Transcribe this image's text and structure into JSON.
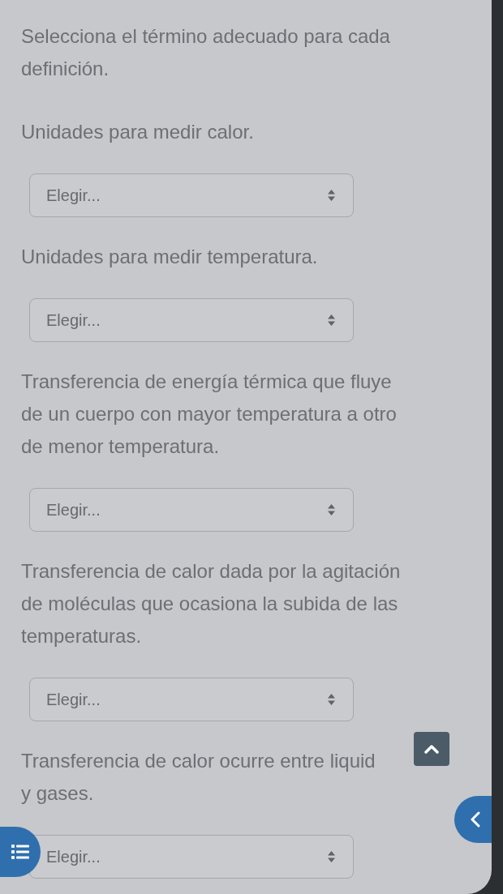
{
  "instructions": "Selecciona el término adecuado para cada definición.",
  "questions": [
    {
      "text": "Unidades para medir calor.",
      "answer": {
        "value": "Elegir..."
      }
    },
    {
      "text": "Unidades para medir temperatura.",
      "answer": {
        "value": "Elegir..."
      }
    },
    {
      "text": "Transferencia de energía térmica que fluye de un cuerpo con mayor temperatura a otro de menor temperatura.",
      "answer": {
        "value": "Elegir..."
      }
    },
    {
      "text": "Transferencia de calor dada por la agitación de moléculas que ocasiona la subida de las temperaturas.",
      "answer": {
        "value": "Elegir..."
      }
    },
    {
      "text": "Transferencia de calor ocurre entre liquid\ny gases.",
      "answer": {
        "value": "Elegir..."
      }
    }
  ]
}
